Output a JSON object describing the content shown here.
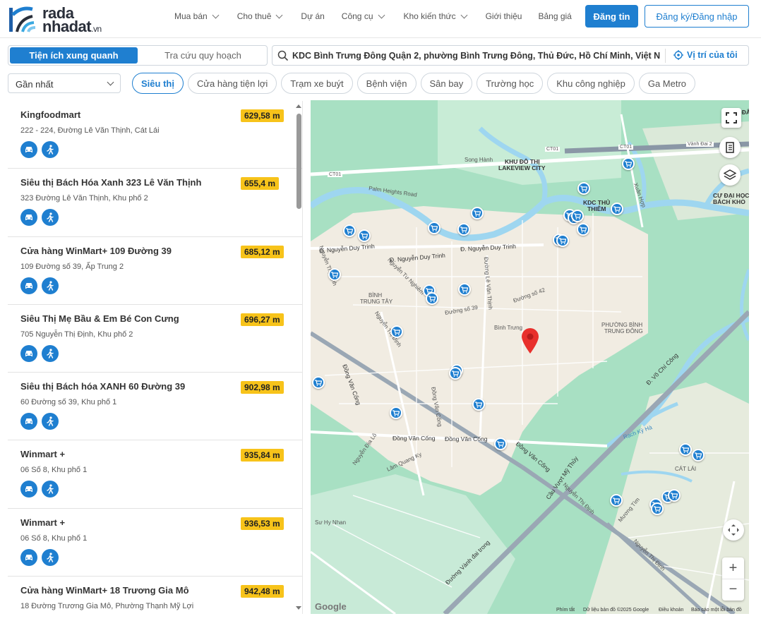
{
  "brand": {
    "logo_line1": "rada",
    "logo_line2": "nhadat",
    "logo_suffix": ".vn"
  },
  "nav": [
    {
      "label": "Mua bán",
      "dropdown": true
    },
    {
      "label": "Cho thuê",
      "dropdown": true
    },
    {
      "label": "Dự án",
      "dropdown": false
    },
    {
      "label": "Công cụ",
      "dropdown": true
    },
    {
      "label": "Kho kiến thức",
      "dropdown": true
    },
    {
      "label": "Giới thiệu",
      "dropdown": false
    },
    {
      "label": "Bảng giá",
      "dropdown": false
    }
  ],
  "header": {
    "post_button": "Đăng tin",
    "login_button": "Đăng ký/Đăng nhập"
  },
  "tabs": {
    "active": "Tiện ích xung quanh",
    "other": "Tra cứu quy hoạch"
  },
  "search": {
    "value": "KDC Bình Trưng Đông Quận 2, phường Bình Trưng Đông, Thủ Đức, Hồ Chí Minh, Việt N",
    "my_location": "Vị trí của tôi"
  },
  "sort": {
    "selected": "Gần nhất"
  },
  "categories": [
    {
      "label": "Siêu thị",
      "active": true
    },
    {
      "label": "Cửa hàng tiện lợi",
      "active": false
    },
    {
      "label": "Trạm xe buýt",
      "active": false
    },
    {
      "label": "Bệnh viện",
      "active": false
    },
    {
      "label": "Sân bay",
      "active": false
    },
    {
      "label": "Trường học",
      "active": false
    },
    {
      "label": "Khu công nghiệp",
      "active": false
    },
    {
      "label": "Ga Metro",
      "active": false
    }
  ],
  "places": [
    {
      "name": "Kingfoodmart",
      "address": "222 - 224, Đường Lê Văn Thịnh, Cát Lái",
      "distance": "629,58 m"
    },
    {
      "name": "Siêu thị Bách Hóa Xanh 323 Lê Văn Thịnh",
      "address": "323 Đường Lê Văn Thịnh, Khu phố 2",
      "distance": "655,4 m"
    },
    {
      "name": "Cửa hàng WinMart+ 109 Đường 39",
      "address": "109 Đường số 39, Ấp Trung 2",
      "distance": "685,12 m"
    },
    {
      "name": "Siêu Thị Mẹ Bầu & Em Bé Con Cưng",
      "address": "705 Nguyễn Thị Định, Khu phố 2",
      "distance": "696,27 m"
    },
    {
      "name": "Siêu thị Bách hóa XANH 60 Đường 39",
      "address": "60 Đường số 39, Khu phố 1",
      "distance": "902,98 m"
    },
    {
      "name": "Winmart +",
      "address": "06 Số 8, Khu phố 1",
      "distance": "935,84 m"
    },
    {
      "name": "Winmart +",
      "address": "06 Số 8, Khu phố 1",
      "distance": "936,53 m"
    },
    {
      "name": "Cửa hàng WinMart+ 18 Trương Gia Mô",
      "address": "18 Đường Trương Gia Mô, Phường Thạnh Mỹ Lợi",
      "distance": "942,48 m"
    }
  ],
  "map": {
    "labels": {
      "kdt": "KHU ĐÔ THỊ",
      "lakeview": "LAKEVIEW CITY",
      "song_hanh": "Song Hành",
      "palm": "Palm Heights Road",
      "ct01a": "CT01",
      "ct01b": "CT01",
      "ct01c": "CT01",
      "vanhdai": "Vành Đai 2",
      "kdc_thu": "KDC THỦ",
      "thiem": "THIÊM",
      "xuan_hop": "Xuân Hợp",
      "ndt1": "Đ. Nguyễn Duy Trinh",
      "ndt2": "Đ. Nguyễn Duy Trinh",
      "ndt3": "Đ. Nguyễn Duy Trinh",
      "ntd1": "Nguyễn Thị Định",
      "ntd2": "Nguyễn Thị Định",
      "ntd3": "Nguyễn Thị Định",
      "ntd4": "Nguyễn Thị Định",
      "binh_trung_tay1": "BÌNH",
      "binh_trung_tay2": "TRUNG TÂY",
      "pbtd1": "PHƯỜNG BÌNH",
      "pbtd2": "TRUNG ĐÔNG",
      "binh_trung": "Bình Trưng",
      "duong42": "Đường số 42",
      "duong39": "Đường số 39",
      "ntn": "Nguyễn Tư Nghiêm",
      "lvt": "Đường Lê Văn Thịnh",
      "dvc1": "Đồng Văn Cống",
      "dvc2": "Đồng Văn Cống",
      "dvc3": "Đồng Văn Cống",
      "dvc4": "Đồng Văn Cống",
      "dvc5": "Đồng Văn Cống",
      "vcs": "Đ. Võ Chí Công",
      "cau_vuot": "Cầu Vượt Mỹ Thủy",
      "rach": "Rạch Kỳ Hà",
      "cat_lai": "CÁT LÁI",
      "su_hy_nhan": "Sư Hy Nhan",
      "lam_quang_ky": "Lâm Quang Ky",
      "nguyen_dia_lo": "Nguyễn Địa Lô",
      "vanh_dai_trong": "Đường Vành đai trong",
      "muong_tim": "Mương Tìm",
      "khu_corner": "KHU ĐÂN",
      "cu_dai_hoc": "CƯ ĐẠI HỌC",
      "bach_khoa": "BÁCH KHO"
    },
    "footer": {
      "shortcuts": "Phím tắt",
      "data": "Dữ liệu bản đồ ©2025 Google",
      "terms": "Điều khoản",
      "report": "Báo cáo một lỗi bản đồ"
    },
    "google": "Google"
  },
  "colors": {
    "accent": "#1f7fd0",
    "distance_badge": "#f7c31a",
    "marker": "#e8302c"
  }
}
